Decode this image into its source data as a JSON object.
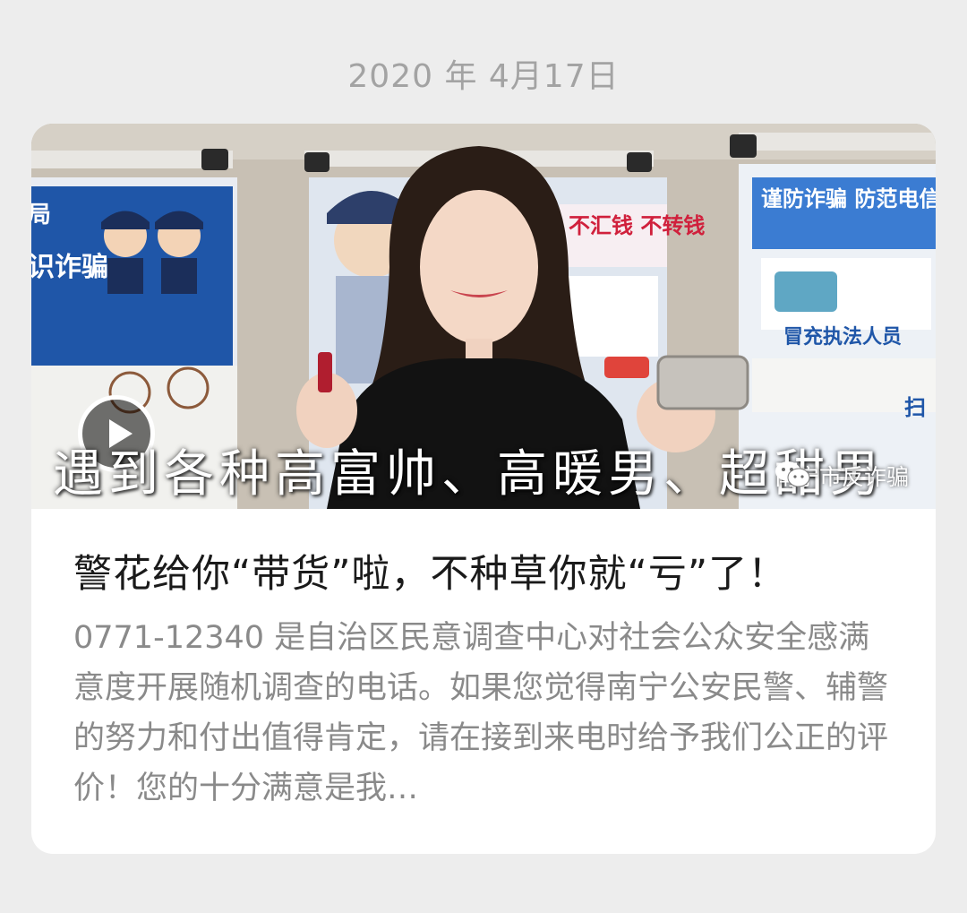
{
  "message": {
    "date": "2020 年 4月17日"
  },
  "article": {
    "video_subtitle": "遇到各种高富帅、高暖男、超甜男",
    "watermark": "南宁市反诈骗",
    "title": "警花给你“带货”啦，不种草你就“亏”了！",
    "summary": "0771-12340 是自治区民意调查中心对社会公众安全感满意度开展随机调查的电话。如果您觉得南宁公安民警、辅警的努力和付出值得肯定，请在接到来电时给予我们公正的评价！您的十分满意是我…"
  },
  "posters": {
    "left_title": "识诈骗",
    "center_title": "不汇钱 不转钱",
    "right_title": "谨防诈骗 防范电信网",
    "right_caption": "冒充执法人员",
    "right_side": "扫"
  },
  "colors": {
    "page_background": "#ededed",
    "card_background": "#ffffff",
    "date_text": "#a3a3a3",
    "title_text": "#1a1a1a",
    "summary_text": "#8a8a8a",
    "poster_blue": "#1f56a8"
  },
  "icons": {
    "play": "play-icon",
    "watermark": "wechat-icon"
  }
}
